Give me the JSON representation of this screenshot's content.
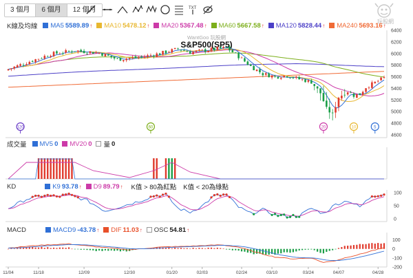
{
  "periods": [
    "3 個月",
    "6 個月",
    "12 個月"
  ],
  "active_period": 1,
  "tools": [
    "line-tool-icon",
    "horizontal-line-tool-icon",
    "curve-tool-icon",
    "wave-pattern-tool-icon",
    "zigzag-tool-icon",
    "circle-tool-icon",
    "fibonacci-tool-icon",
    "hide-drawings-icon"
  ],
  "logo_text": "玩股網",
  "kline": {
    "label": "K線及均線",
    "watermark": "WantGoo 玩股網",
    "title": "S&P500(SP5)",
    "ma": [
      {
        "name": "MA5",
        "value": "5589.89",
        "color": "#2f6fd6"
      },
      {
        "name": "MA10",
        "value": "5478.12",
        "color": "#e8b730"
      },
      {
        "name": "MA20",
        "value": "5367.48",
        "color": "#cc3aa8"
      },
      {
        "name": "MA60",
        "value": "5667.58",
        "color": "#7cae1a"
      },
      {
        "name": "MA120",
        "value": "5828.44",
        "color": "#4b3fc7"
      },
      {
        "name": "MA240",
        "value": "5693.16",
        "color": "#f06a35"
      }
    ],
    "y_ticks": [
      "6400",
      "6200",
      "6000",
      "5800",
      "5600",
      "5400",
      "5200",
      "5000",
      "4800",
      "4600"
    ],
    "event_markers": [
      {
        "label": "120",
        "color": "#6b3fc7"
      },
      {
        "label": "60",
        "color": "#7cae1a"
      },
      {
        "label": "20",
        "color": "#cc3aa8"
      },
      {
        "label": "10",
        "color": "#e8b730"
      },
      {
        "label": "5",
        "color": "#2f6fd6"
      }
    ]
  },
  "volume": {
    "label": "成交量",
    "items": [
      {
        "name": "MV5",
        "value": "0",
        "color": "#2f6fd6"
      },
      {
        "name": "MV20",
        "value": "0",
        "color": "#cc3aa8"
      },
      {
        "name": "量",
        "value": "0",
        "color": "#ffffff"
      }
    ]
  },
  "kd": {
    "label": "KD",
    "items": [
      {
        "name": "K9",
        "value": "93.78",
        "color": "#2f6fd6",
        "arrow": "↑"
      },
      {
        "name": "D9",
        "value": "89.79",
        "color": "#cc3aa8",
        "arrow": "↑"
      }
    ],
    "notes": [
      "K值 > 80為紅點",
      "K值 < 20為綠點"
    ],
    "y_ticks": [
      "100",
      "50",
      "0"
    ]
  },
  "macd": {
    "label": "MACD",
    "items": [
      {
        "name": "MACD9",
        "value": "-43.78",
        "color": "#2f6fd6",
        "arrow": "↑"
      },
      {
        "name": "DIF",
        "value": "11.03",
        "color": "#e8502a",
        "arrow": "↑"
      },
      {
        "name": "OSC",
        "value": "54.81",
        "color": "#ffffff",
        "arrow": "↑"
      }
    ],
    "y_ticks": [
      "100",
      "0",
      "-100",
      "-200"
    ]
  },
  "x_axis": [
    "11/04",
    "11/18",
    "12/09",
    "12/30",
    "01/20",
    "02/03",
    "02/24",
    "03/10",
    "03/24",
    "04/07",
    "04/28"
  ]
}
